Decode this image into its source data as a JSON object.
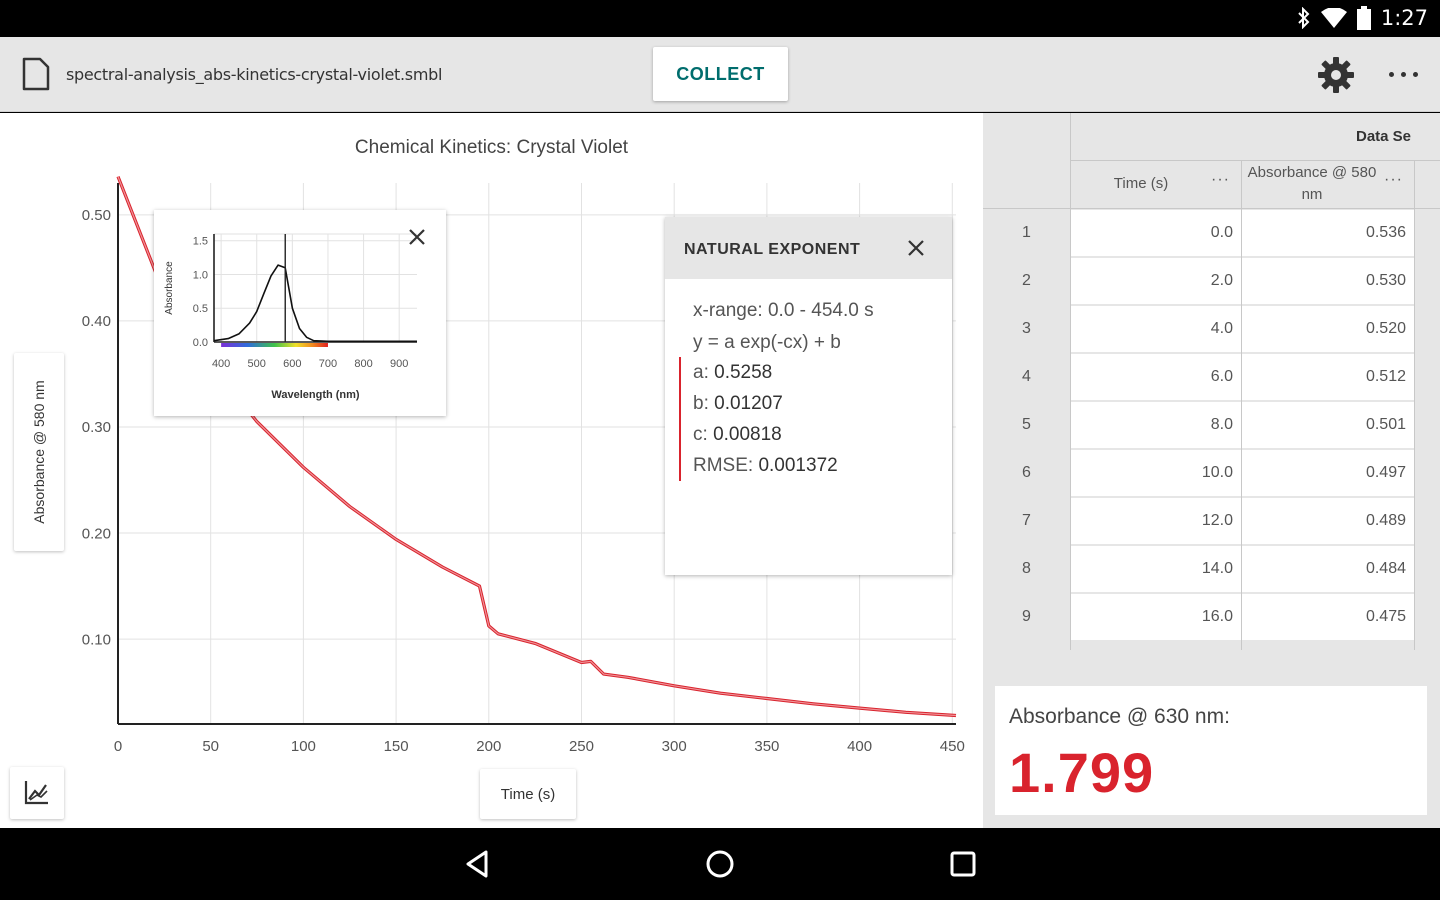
{
  "status_bar": {
    "time": "1:27",
    "icons": [
      "bluetooth-icon",
      "wifi-icon",
      "battery-icon"
    ]
  },
  "toolbar": {
    "file_name": "spectral-analysis_abs-kinetics-crystal-violet.smbl",
    "collect_label": "COLLECT",
    "icons": [
      "file-icon",
      "gear-icon",
      "more-icon"
    ]
  },
  "graph": {
    "title": "Chemical Kinetics: Crystal Violet",
    "ylabel": "Absorbance @ 580 nm",
    "xlabel": "Time (s)",
    "accent_color": "#d9232d"
  },
  "chart_data": [
    {
      "type": "line",
      "title": "Chemical Kinetics: Crystal Violet",
      "xlabel": "Time (s)",
      "ylabel": "Absorbance @ 580 nm",
      "xlim": [
        0,
        452
      ],
      "ylim": [
        0.02,
        0.53
      ],
      "xticks": [
        0,
        50,
        100,
        150,
        200,
        250,
        300,
        350,
        400,
        450
      ],
      "yticks": [
        0.1,
        0.2,
        0.3,
        0.4,
        0.5
      ],
      "xtick_labels": [
        "0",
        "50",
        "100",
        "150",
        "200",
        "250",
        "300",
        "350",
        "400",
        "450"
      ],
      "ytick_labels": [
        "0.10",
        "0.20",
        "0.30",
        "0.40",
        "0.50"
      ],
      "grid": true,
      "series": [
        {
          "color": "#d9232d",
          "x": [
            0,
            25,
            50,
            75,
            100,
            125,
            150,
            175,
            195,
            200,
            205,
            225,
            250,
            255,
            262,
            275,
            300,
            325,
            350,
            375,
            400,
            425,
            452
          ],
          "y": [
            0.536,
            0.425,
            0.359,
            0.305,
            0.262,
            0.225,
            0.194,
            0.168,
            0.15,
            0.1125,
            0.105,
            0.096,
            0.078,
            0.079,
            0.067,
            0.064,
            0.056,
            0.049,
            0.044,
            0.039,
            0.035,
            0.031,
            0.028
          ]
        }
      ]
    },
    {
      "type": "line",
      "xlabel": "Wavelength (nm)",
      "ylabel": "Absorbance",
      "xlim": [
        380,
        950
      ],
      "ylim": [
        0,
        1.6
      ],
      "xticks": [
        400,
        500,
        600,
        700,
        800,
        900
      ],
      "yticks": [
        0.0,
        0.5,
        1.0,
        1.5
      ],
      "xtick_labels": [
        "400",
        "500",
        "600",
        "700",
        "800",
        "900"
      ],
      "ytick_labels": [
        "0.0",
        "0.5",
        "1.0",
        "1.5"
      ],
      "marker_x": 580,
      "grid": true,
      "series": [
        {
          "color": "#111111",
          "x": [
            380,
            420,
            450,
            480,
            500,
            520,
            540,
            560,
            580,
            590,
            600,
            620,
            640,
            660,
            700,
            800,
            950
          ],
          "y": [
            0.02,
            0.05,
            0.12,
            0.28,
            0.45,
            0.72,
            0.98,
            1.14,
            1.1,
            0.8,
            0.5,
            0.2,
            0.07,
            0.02,
            0.01,
            0.01,
            0.01
          ]
        }
      ]
    }
  ],
  "fit_panel": {
    "title": "NATURAL EXPONENT",
    "x_range": "x-range: 0.0 - 454.0 s",
    "equation": "y = a exp(-cx) + b",
    "params": [
      {
        "label": "a: ",
        "value": "0.5258"
      },
      {
        "label": "b: ",
        "value": "0.01207"
      },
      {
        "label": "c: ",
        "value": "0.00818"
      },
      {
        "label": "RMSE: ",
        "value": "0.001372"
      }
    ]
  },
  "table": {
    "dataset_label": "Data Se",
    "columns": [
      "Time (s)",
      "Absorbance @ 580 nm"
    ],
    "column_menu": "···",
    "rows": [
      {
        "n": "1",
        "time": "0.0",
        "abs": "0.536"
      },
      {
        "n": "2",
        "time": "2.0",
        "abs": "0.530"
      },
      {
        "n": "3",
        "time": "4.0",
        "abs": "0.520"
      },
      {
        "n": "4",
        "time": "6.0",
        "abs": "0.512"
      },
      {
        "n": "5",
        "time": "8.0",
        "abs": "0.501"
      },
      {
        "n": "6",
        "time": "10.0",
        "abs": "0.497"
      },
      {
        "n": "7",
        "time": "12.0",
        "abs": "0.489"
      },
      {
        "n": "8",
        "time": "14.0",
        "abs": "0.484"
      },
      {
        "n": "9",
        "time": "16.0",
        "abs": "0.475"
      }
    ]
  },
  "meter": {
    "label": "Absorbance @ 630 nm:",
    "value": "1.799"
  },
  "nav": {
    "icons": [
      "back-icon",
      "home-icon",
      "recents-icon"
    ]
  }
}
